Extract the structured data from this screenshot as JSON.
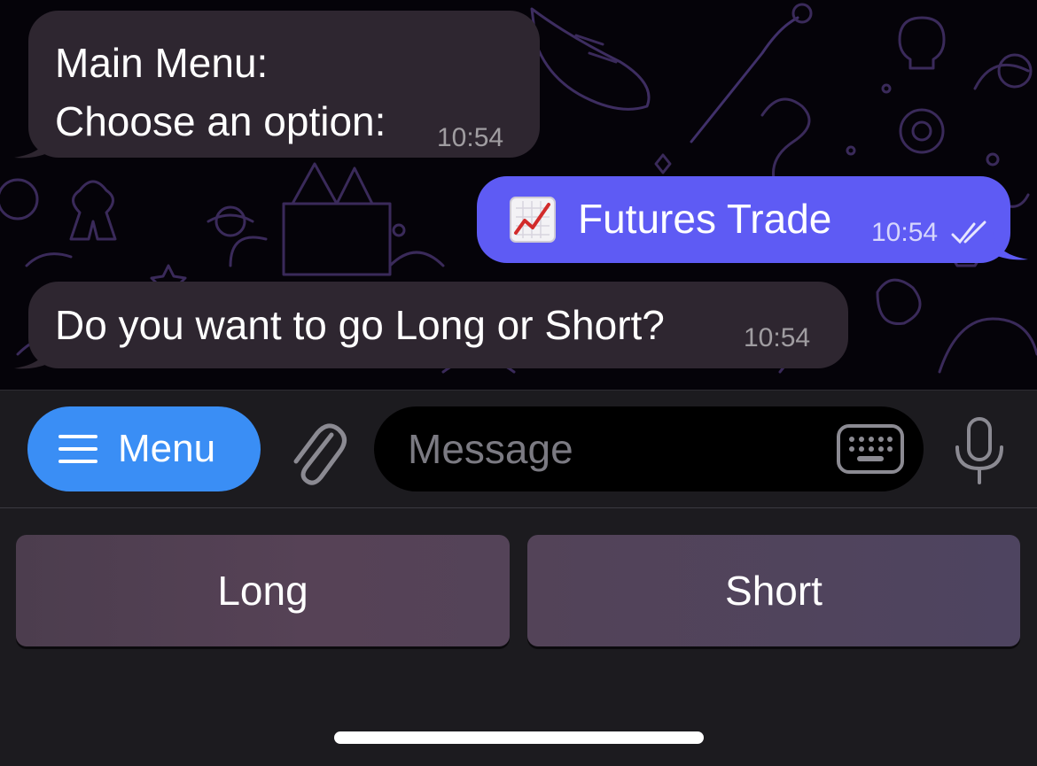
{
  "chat": {
    "messages": [
      {
        "direction": "incoming",
        "text": "Main Menu:\nChoose an option:",
        "time": "10:54"
      },
      {
        "direction": "outgoing",
        "emoji": "chart-increasing-icon",
        "text": "Futures Trade",
        "time": "10:54",
        "status": "read"
      },
      {
        "direction": "incoming",
        "text": "Do you want to go Long or Short?",
        "time": "10:54"
      }
    ]
  },
  "input_bar": {
    "menu_label": "Menu",
    "message_placeholder": "Message"
  },
  "reply_keyboard": {
    "buttons": [
      "Long",
      "Short"
    ]
  },
  "colors": {
    "incoming_bubble": "#2e2630",
    "outgoing_bubble": "#5e5bf4",
    "menu_button": "#3a8ef5",
    "chat_background": "#050309",
    "panel_background": "#1c1b1f"
  }
}
